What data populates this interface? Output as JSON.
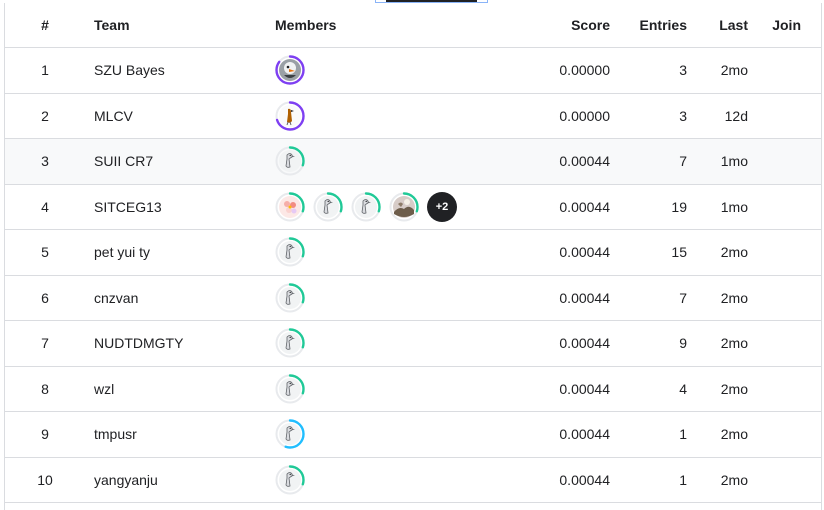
{
  "header": {
    "rank": "#",
    "team": "Team",
    "members": "Members",
    "score": "Score",
    "entries": "Entries",
    "last": "Last",
    "join": "Join"
  },
  "colors": {
    "tier_green": "#20BEFF",
    "tier_purple": "#7e3ff2",
    "tier_teal": "#20beff",
    "tier_mint": "#20c997"
  },
  "rows": [
    {
      "rank": "1",
      "team": "SZU Bayes",
      "score": "0.00000",
      "entries": "3",
      "last": "2mo",
      "members": [
        {
          "icon": "puffin-avatar-icon",
          "ring": "purple",
          "progress": 0.85
        }
      ]
    },
    {
      "rank": "2",
      "team": "MLCV",
      "score": "0.00000",
      "entries": "3",
      "last": "12d",
      "members": [
        {
          "icon": "bird-avatar-icon",
          "ring": "purple",
          "progress": 0.7
        }
      ]
    },
    {
      "rank": "3",
      "team": "SUII CR7",
      "score": "0.00044",
      "entries": "7",
      "last": "1mo",
      "members": [
        {
          "icon": "default-goose-avatar-icon",
          "ring": "mint",
          "progress": 0.3
        }
      ]
    },
    {
      "rank": "4",
      "team": "SITCEG13",
      "score": "0.00044",
      "entries": "19",
      "last": "1mo",
      "members": [
        {
          "icon": "flower-avatar-icon",
          "ring": "mint",
          "progress": 0.3
        },
        {
          "icon": "default-goose-avatar-icon",
          "ring": "mint",
          "progress": 0.3
        },
        {
          "icon": "default-goose-avatar-icon",
          "ring": "mint",
          "progress": 0.3
        },
        {
          "icon": "photo-avatar-icon",
          "ring": "mint",
          "progress": 0.3
        }
      ],
      "more": "+2"
    },
    {
      "rank": "5",
      "team": "pet yui ty",
      "score": "0.00044",
      "entries": "15",
      "last": "2mo",
      "members": [
        {
          "icon": "default-goose-avatar-icon",
          "ring": "mint",
          "progress": 0.3
        }
      ]
    },
    {
      "rank": "6",
      "team": "cnzvan",
      "score": "0.00044",
      "entries": "7",
      "last": "2mo",
      "members": [
        {
          "icon": "default-goose-avatar-icon",
          "ring": "mint",
          "progress": 0.3
        }
      ]
    },
    {
      "rank": "7",
      "team": "NUDTDMGTY",
      "score": "0.00044",
      "entries": "9",
      "last": "2mo",
      "members": [
        {
          "icon": "default-goose-avatar-icon",
          "ring": "mint",
          "progress": 0.3
        }
      ]
    },
    {
      "rank": "8",
      "team": "wzl",
      "score": "0.00044",
      "entries": "4",
      "last": "2mo",
      "members": [
        {
          "icon": "default-goose-avatar-icon",
          "ring": "mint",
          "progress": 0.3
        }
      ]
    },
    {
      "rank": "9",
      "team": "tmpusr",
      "score": "0.00044",
      "entries": "1",
      "last": "2mo",
      "members": [
        {
          "icon": "default-goose-avatar-icon",
          "ring": "teal",
          "progress": 0.55
        }
      ]
    },
    {
      "rank": "10",
      "team": "yangyanju",
      "score": "0.00044",
      "entries": "1",
      "last": "2mo",
      "members": [
        {
          "icon": "default-goose-avatar-icon",
          "ring": "mint",
          "progress": 0.3
        }
      ]
    }
  ]
}
